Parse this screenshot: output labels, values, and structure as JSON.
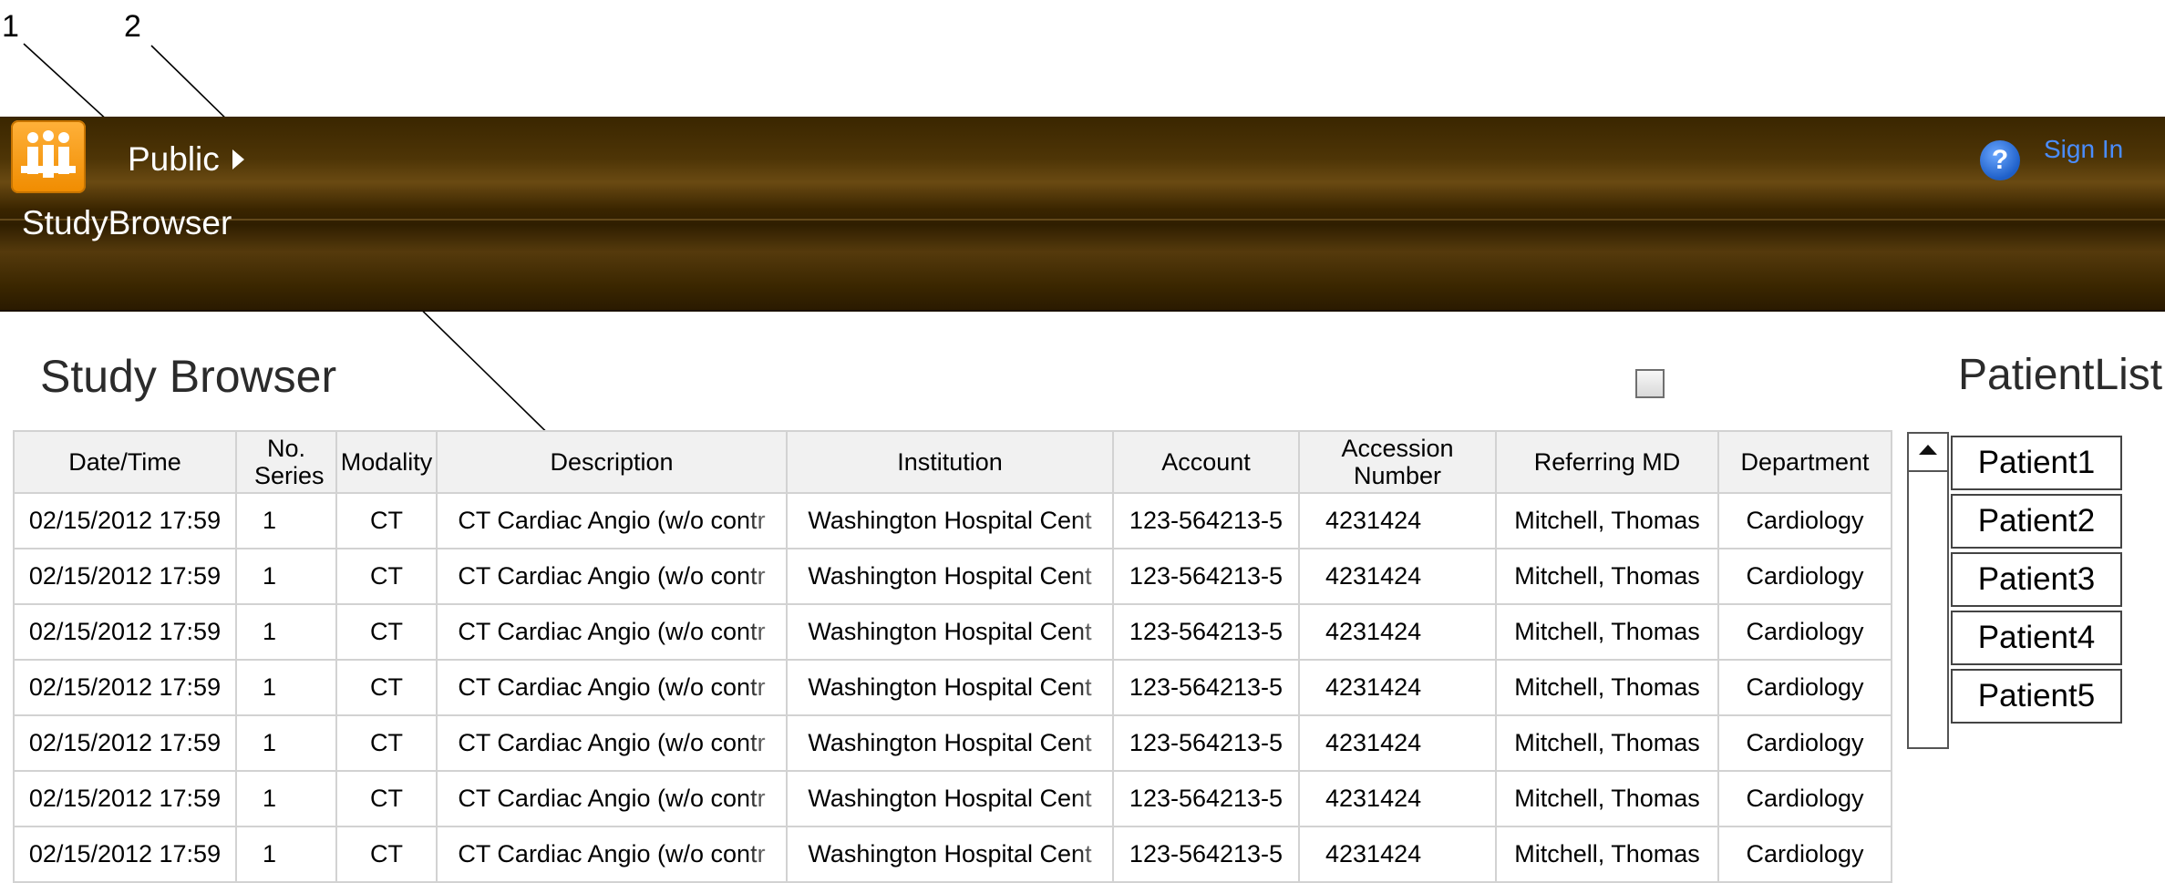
{
  "callouts": [
    "1",
    "2"
  ],
  "header": {
    "breadcrumb": "Public",
    "app_title": "StudyBrowser",
    "help_glyph": "?",
    "sign_in": "Sign In"
  },
  "study_browser": {
    "title": "Study Browser",
    "columns": [
      "Date/Time",
      "No. Series",
      "Modality",
      "Description",
      "Institution",
      "Account",
      "Accession Number",
      "Referring MD",
      "Department"
    ],
    "rows": [
      [
        "02/15/2012 17:59",
        "1",
        "CT",
        "CT Cardiac Angio (w/o contr",
        "Washington Hospital Cent",
        "123-564213-5",
        "4231424",
        "Mitchell, Thomas",
        "Cardiology"
      ],
      [
        "02/15/2012 17:59",
        "1",
        "CT",
        "CT Cardiac Angio (w/o contr",
        "Washington Hospital Cent",
        "123-564213-5",
        "4231424",
        "Mitchell, Thomas",
        "Cardiology"
      ],
      [
        "02/15/2012 17:59",
        "1",
        "CT",
        "CT Cardiac Angio (w/o contr",
        "Washington Hospital Cent",
        "123-564213-5",
        "4231424",
        "Mitchell, Thomas",
        "Cardiology"
      ],
      [
        "02/15/2012 17:59",
        "1",
        "CT",
        "CT Cardiac Angio (w/o contr",
        "Washington Hospital Cent",
        "123-564213-5",
        "4231424",
        "Mitchell, Thomas",
        "Cardiology"
      ],
      [
        "02/15/2012 17:59",
        "1",
        "CT",
        "CT Cardiac Angio (w/o contr",
        "Washington Hospital Cent",
        "123-564213-5",
        "4231424",
        "Mitchell, Thomas",
        "Cardiology"
      ],
      [
        "02/15/2012 17:59",
        "1",
        "CT",
        "CT Cardiac Angio (w/o contr",
        "Washington Hospital Cent",
        "123-564213-5",
        "4231424",
        "Mitchell, Thomas",
        "Cardiology"
      ],
      [
        "02/15/2012 17:59",
        "1",
        "CT",
        "CT Cardiac Angio (w/o contr",
        "Washington Hospital Cent",
        "123-564213-5",
        "4231424",
        "Mitchell, Thomas",
        "Cardiology"
      ]
    ]
  },
  "patient_list": {
    "title": "PatientList",
    "items": [
      "Patient1",
      "Patient2",
      "Patient3",
      "Patient4",
      "Patient5"
    ]
  },
  "colors": {
    "header_bg": "#3a2600",
    "logo_orange": "#f59a12",
    "sign_in_link": "#4a8dff",
    "help_icon": "#1e5fc8"
  },
  "icons": {
    "logo": "people-group-icon",
    "breadcrumb_arrow": "triangle-right-icon",
    "help": "question-circle-icon",
    "scroll_up": "triangle-up-icon"
  }
}
